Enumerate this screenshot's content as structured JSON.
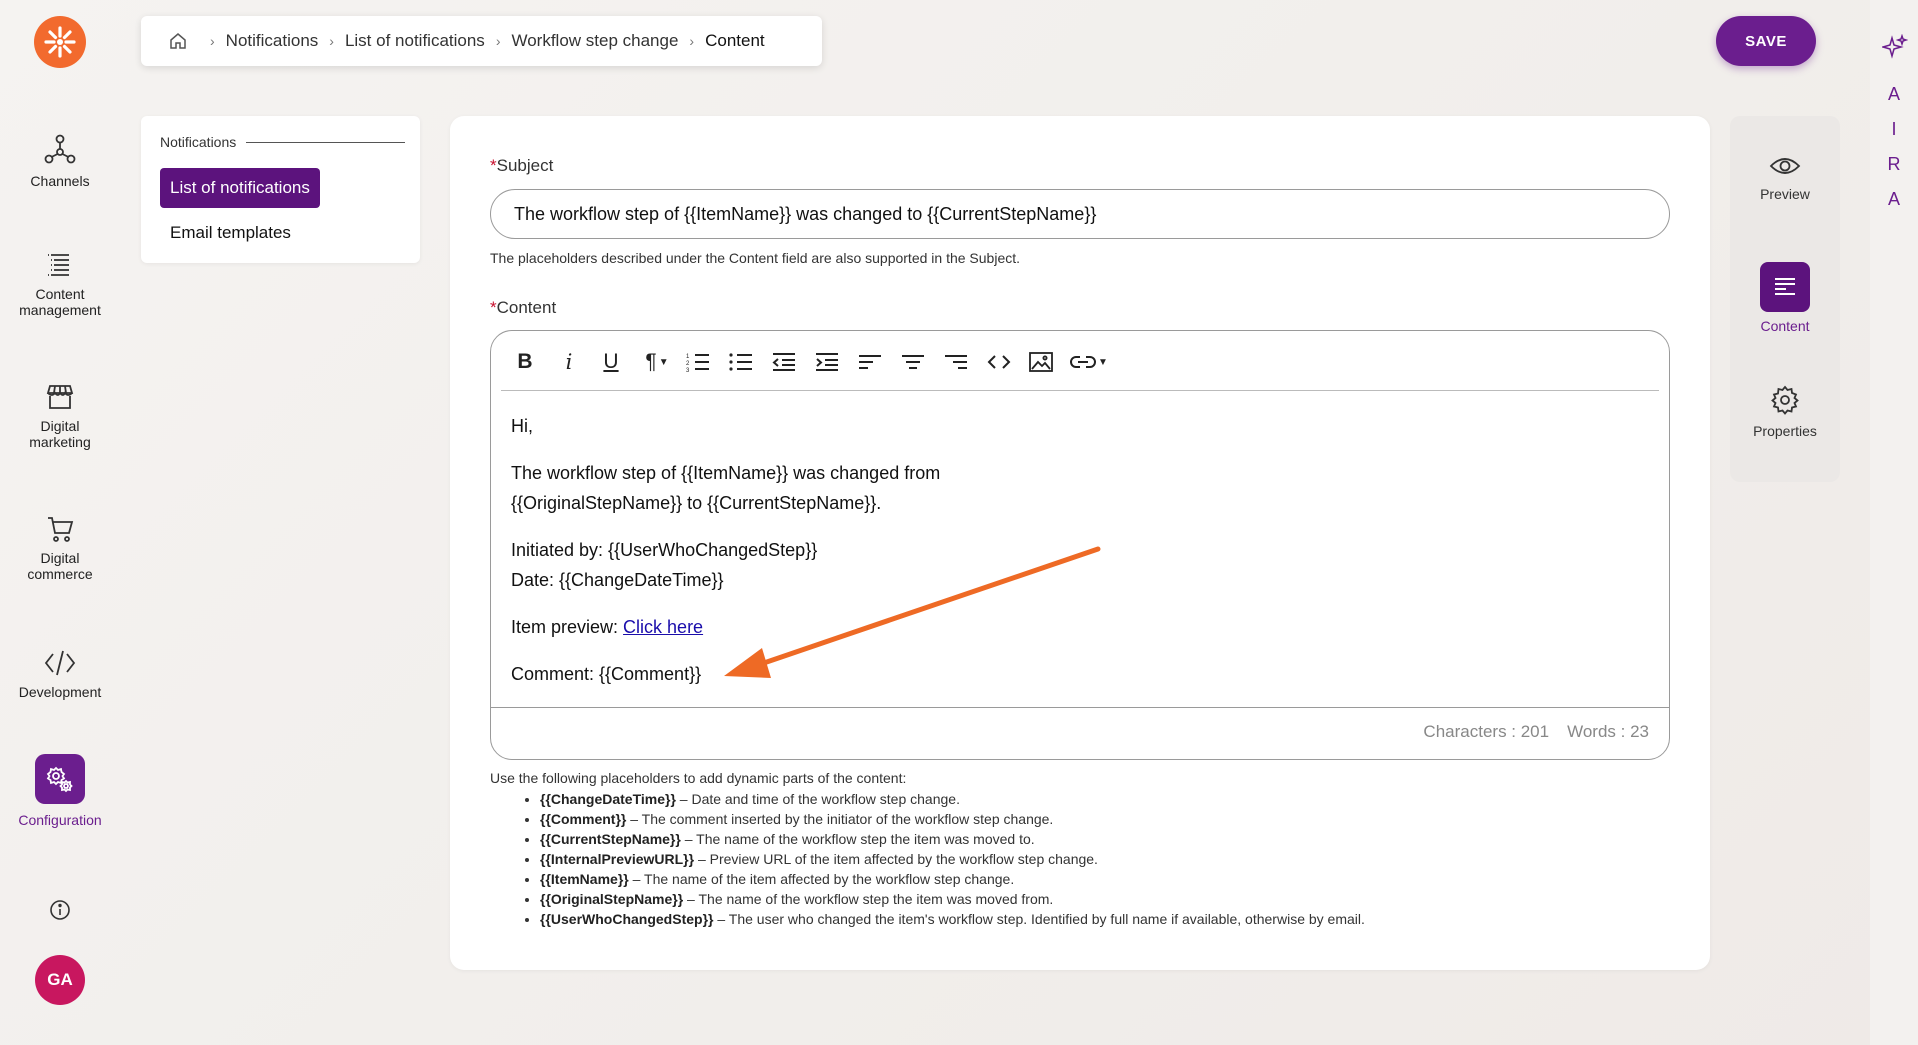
{
  "rail": {
    "items": [
      {
        "label_lines": [
          "Channels"
        ],
        "icon": "channels-icon"
      },
      {
        "label_lines": [
          "Content",
          "management"
        ],
        "icon": "content-management-icon"
      },
      {
        "label_lines": [
          "Digital",
          "marketing"
        ],
        "icon": "storefront-icon"
      },
      {
        "label_lines": [
          "Digital",
          "commerce"
        ],
        "icon": "cart-icon"
      },
      {
        "label_lines": [
          "Development"
        ],
        "icon": "code-icon"
      },
      {
        "label_lines": [
          "Configuration"
        ],
        "icon": "configuration-gears-icon"
      }
    ],
    "avatar_initials": "GA"
  },
  "breadcrumb": {
    "items": [
      "Notifications",
      "List of notifications",
      "Workflow step change"
    ],
    "current": "Content"
  },
  "toolbar": {
    "save_label": "SAVE"
  },
  "aira": {
    "letters": [
      "A",
      "I",
      "R",
      "A"
    ]
  },
  "subnav": {
    "heading": "Notifications",
    "active_item": "List of notifications",
    "item": "Email templates"
  },
  "form": {
    "subject_label": "Subject",
    "subject_value": "The workflow step of {{ItemName}} was changed to {{CurrentStepName}}",
    "subject_hint": "The placeholders described under the Content field are also supported in the Subject.",
    "content_label": "Content",
    "required_mark": "*"
  },
  "editor": {
    "tools": [
      "bold",
      "italic",
      "underline",
      "paragraph-format",
      "ordered-list",
      "unordered-list",
      "outdent",
      "indent",
      "align-left",
      "align-center",
      "align-right",
      "code-view",
      "insert-image",
      "insert-link"
    ],
    "body": {
      "greeting": "Hi,",
      "line1": "The workflow step of {{ItemName}} was changed from",
      "line2": "{{OriginalStepName}} to {{CurrentStepName}}.",
      "initiated": "Initiated by: {{UserWhoChangedStep}}",
      "date": "Date: {{ChangeDateTime}}",
      "preview_prefix": "Item preview: ",
      "preview_link": "Click here",
      "comment": "Comment: {{Comment}}"
    },
    "characters": "Characters : 201",
    "words": "Words : 23"
  },
  "placeholders": {
    "intro": "Use the following placeholders to add dynamic parts of the content:",
    "items": [
      {
        "name": "{{ChangeDateTime}}",
        "desc": " – Date and time of the workflow step change."
      },
      {
        "name": "{{Comment}}",
        "desc": " – The comment inserted by the initiator of the workflow step change."
      },
      {
        "name": "{{CurrentStepName}}",
        "desc": " – The name of the workflow step the item was moved to."
      },
      {
        "name": "{{InternalPreviewURL}}",
        "desc": " – Preview URL of the item affected by the workflow step change."
      },
      {
        "name": "{{ItemName}}",
        "desc": " – The name of the item affected by the workflow step change."
      },
      {
        "name": "{{OriginalStepName}}",
        "desc": " – The name of the workflow step the item was moved from."
      },
      {
        "name": "{{UserWhoChangedStep}}",
        "desc": " – The user who changed the item's workflow step. Identified by full name if available, otherwise by email."
      }
    ]
  },
  "right_panel": {
    "preview_label": "Preview",
    "content_label": "Content",
    "properties_label": "Properties"
  },
  "colors": {
    "accent": "#6b1e8e",
    "brand": "#f26a2e",
    "annotation": "#ee6a25",
    "avatar": "#c8175f"
  }
}
